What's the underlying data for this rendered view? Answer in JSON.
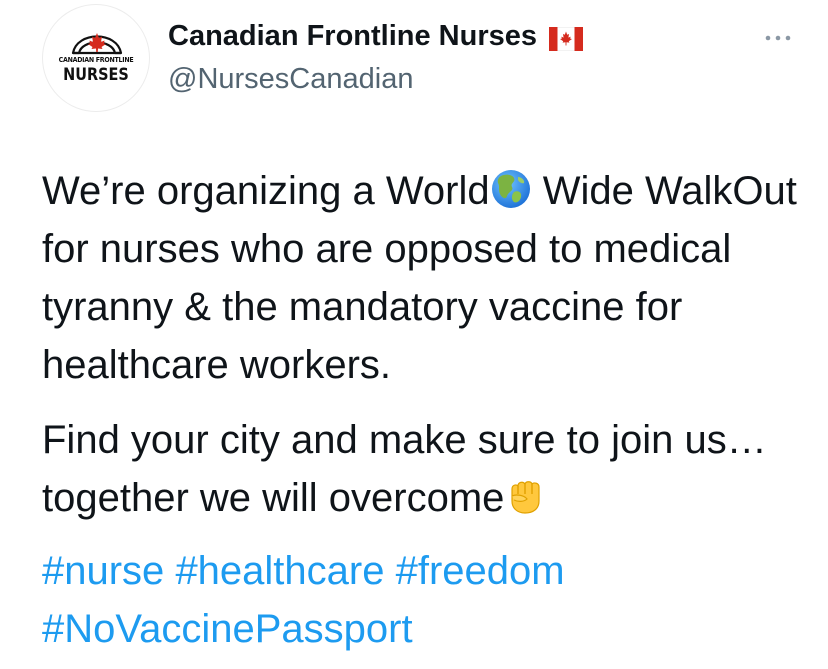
{
  "author": {
    "avatar_text_small": "CANADIAN FRONTLINE",
    "avatar_text_big": "NURSES",
    "display_name": "Canadian Frontline Nurses",
    "handle": "@NursesCanadian",
    "flag_icon": "canada-flag-icon"
  },
  "menu": {
    "icon": "more-options-icon"
  },
  "tweet": {
    "para1_part1": "We’re organizing a World",
    "para1_part2": " Wide WalkOut for nurses who are opposed to medical tyranny & the mandatory vaccine for healthcare workers.",
    "para2": "Find your city and make sure to join us…together we will overcome",
    "emoji_1": "globe-americas-emoji",
    "emoji_2": "raised-fist-emoji"
  },
  "hashtags": [
    "#nurse",
    "#healthcare",
    "#freedom",
    "#NoVaccinePassport"
  ],
  "colors": {
    "text": "#0f1419",
    "secondary": "#536471",
    "link": "#1d9bf0",
    "maple_red": "#d52b1e"
  }
}
